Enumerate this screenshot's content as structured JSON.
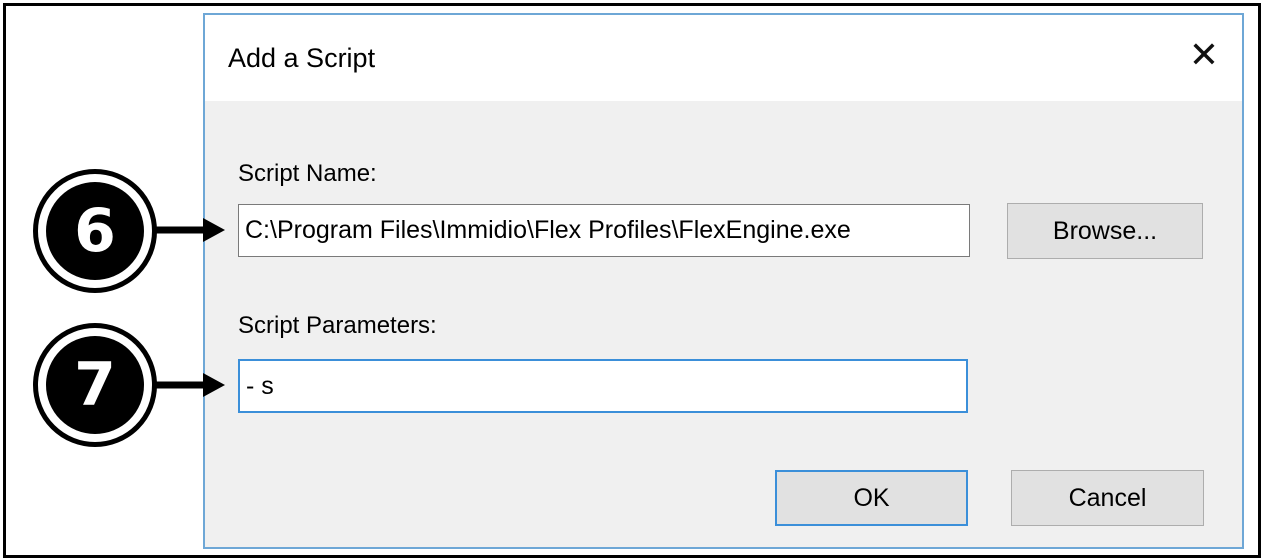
{
  "dialog": {
    "title": "Add a Script",
    "close_glyph": "✕",
    "script_name": {
      "label": "Script Name:",
      "value": "C:\\Program Files\\Immidio\\Flex Profiles\\FlexEngine.exe"
    },
    "browse_label": "Browse...",
    "script_parameters": {
      "label": "Script Parameters:",
      "value": "- s"
    },
    "ok_label": "OK",
    "cancel_label": "Cancel"
  },
  "callouts": [
    {
      "number": "6"
    },
    {
      "number": "7"
    }
  ],
  "colors": {
    "accent": "#3b8fd9",
    "dialog_border": "#6ea7d6",
    "dialog_body": "#f0f0f0",
    "button_face": "#e1e1e1"
  }
}
